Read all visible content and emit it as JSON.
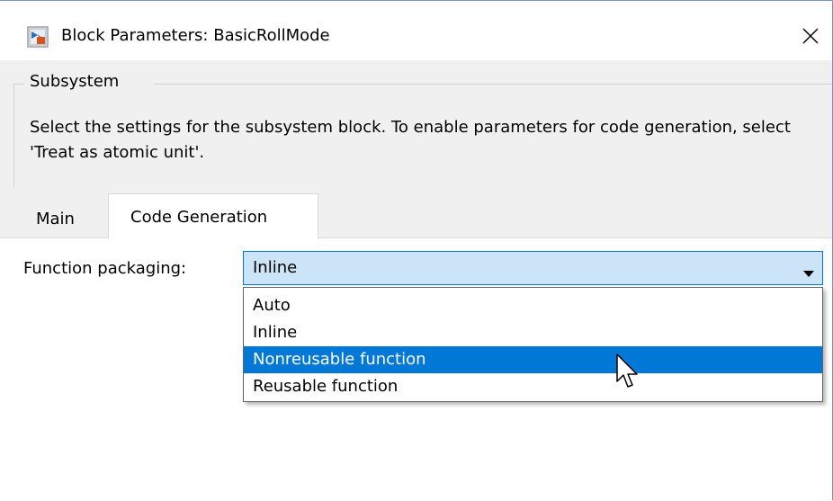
{
  "window": {
    "title": "Block Parameters: BasicRollMode",
    "app_icon": "simulink-block-icon",
    "close_icon": "close-icon"
  },
  "group": {
    "title": "Subsystem",
    "description": "Select the settings for the subsystem block. To enable parameters for code generation, select 'Treat as atomic unit'."
  },
  "tabs": [
    {
      "label": "Main",
      "selected": false
    },
    {
      "label": "Code Generation",
      "selected": true
    }
  ],
  "form": {
    "function_packaging": {
      "label": "Function packaging:",
      "value": "Inline",
      "options": [
        {
          "label": "Auto"
        },
        {
          "label": "Inline"
        },
        {
          "label": "Nonreusable function",
          "hovered": true
        },
        {
          "label": "Reusable function"
        }
      ]
    }
  },
  "colors": {
    "accent": "#0078d7",
    "combo_background": "#cce4f7",
    "dialog_background": "#f0f0f0",
    "content_background": "#ffffff"
  },
  "cursor": "arrow-cursor-icon"
}
